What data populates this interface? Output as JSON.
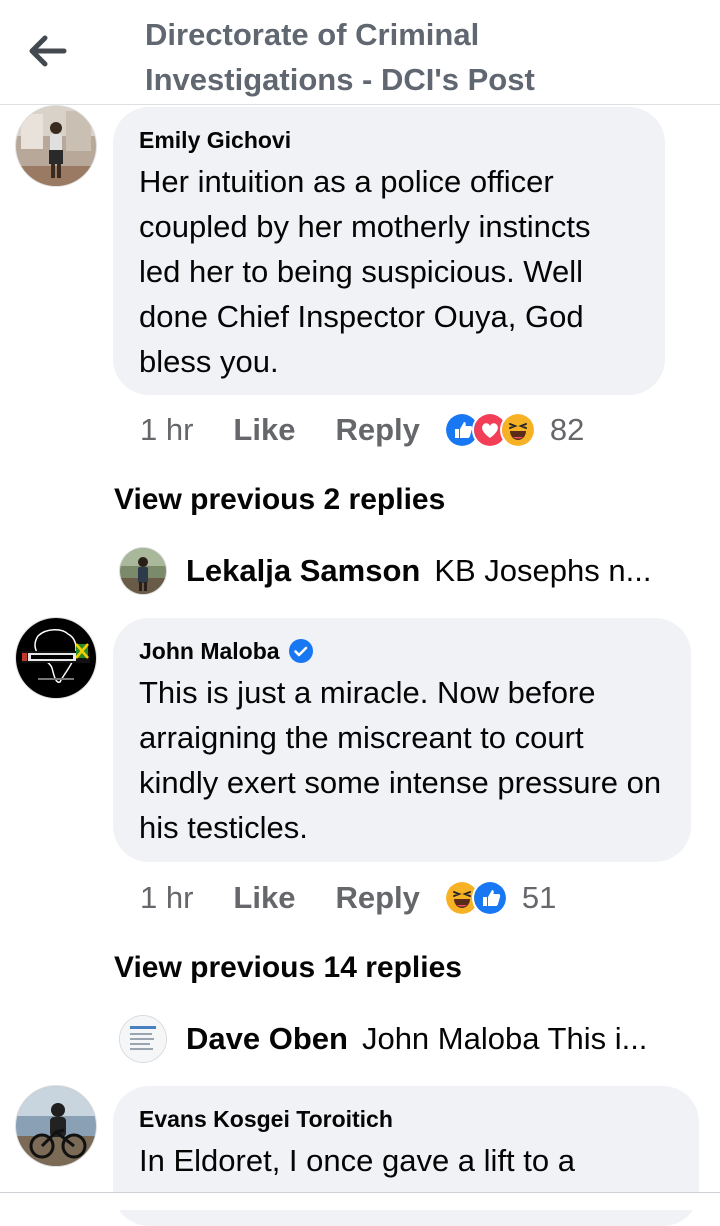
{
  "header": {
    "title": "Directorate of Criminal Investigations - DCI's Post",
    "back_icon": "arrow-left-icon"
  },
  "comments": [
    {
      "author": "Emily Gichovi",
      "verified": false,
      "text": "Her intuition as a police officer coupled by her motherly instincts led her to being suspicious. Well done Chief Inspector Ouya, God bless you.",
      "time": "1 hr",
      "like_label": "Like",
      "reply_label": "Reply",
      "reactions": [
        "like-icon",
        "love-icon",
        "haha-icon"
      ],
      "reaction_count": "82",
      "view_previous": "View previous 2 replies",
      "latest_reply": {
        "author": "Lekalja Samson",
        "snippet": "KB Josephs n..."
      }
    },
    {
      "author": "John Maloba",
      "verified": true,
      "text": "This is just a miracle. Now before arraigning the miscreant to court kindly exert some intense pressure on his testicles.",
      "time": "1 hr",
      "like_label": "Like",
      "reply_label": "Reply",
      "reactions": [
        "haha-icon",
        "like-icon"
      ],
      "reaction_count": "51",
      "view_previous": "View previous 14 replies",
      "latest_reply": {
        "author": "Dave Oben",
        "snippet": "John Maloba This i..."
      }
    },
    {
      "author": "Evans Kosgei Toroitich",
      "verified": false,
      "text": "In Eldoret, I once gave a lift to a"
    }
  ],
  "colors": {
    "bubble": "#f0f2f5",
    "secondary_text": "#65676b",
    "like_blue": "#1877f2",
    "love_red": "#f33e58",
    "haha_yellow": "#f7b125"
  }
}
